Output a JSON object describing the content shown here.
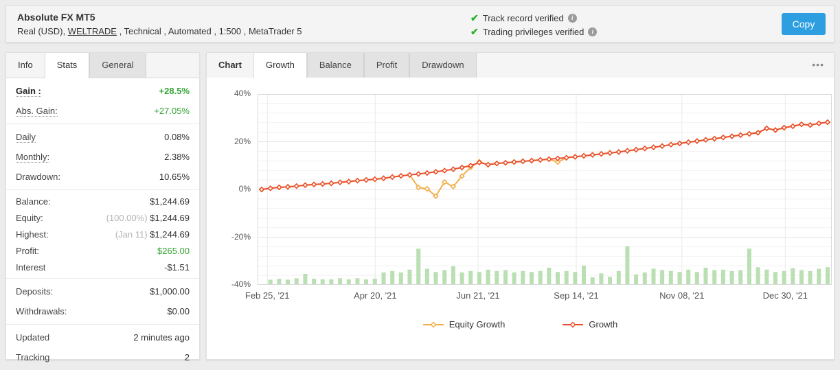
{
  "header": {
    "title": "Absolute FX MT5",
    "subtitle_pre": "Real (USD), ",
    "broker": "WELTRADE",
    "subtitle_post": " , Technical , Automated , 1:500 , MetaTrader 5",
    "verifications": [
      {
        "label": "Track record verified"
      },
      {
        "label": "Trading privileges verified"
      }
    ],
    "copy_button_label": "Copy"
  },
  "left_panel": {
    "tabs": [
      {
        "label": "Info",
        "style": "plain"
      },
      {
        "label": "Stats",
        "style": "active"
      },
      {
        "label": "General",
        "style": "inactive"
      }
    ],
    "groups": [
      {
        "rows": [
          {
            "label": "Gain :",
            "value": "+28.5%",
            "label_style": "bold dotted",
            "value_style": "green bold"
          },
          {
            "label": "Abs. Gain:",
            "value": "+27.05%",
            "label_style": "dotted",
            "value_style": "green"
          }
        ]
      },
      {
        "rows": [
          {
            "label": "Daily",
            "value": "0.08%",
            "label_style": "dotted"
          },
          {
            "label": "Monthly:",
            "value": "2.38%",
            "label_style": "dotted"
          },
          {
            "label": "Drawdown:",
            "value": "10.65%"
          }
        ]
      },
      {
        "compact": true,
        "rows": [
          {
            "label": "Balance:",
            "value": "$1,244.69"
          },
          {
            "label": "Equity:",
            "value_prefix": "(100.00%) ",
            "value": "$1,244.69"
          },
          {
            "label": "Highest:",
            "value_prefix": "(Jan 11) ",
            "value": "$1,244.69"
          },
          {
            "label": "Profit:",
            "value": "$265.00",
            "value_style": "green"
          },
          {
            "label": "Interest",
            "value": "-$1.51"
          }
        ]
      },
      {
        "rows": [
          {
            "label": "Deposits:",
            "value": "$1,000.00"
          },
          {
            "label": "Withdrawals:",
            "value": "$0.00"
          }
        ]
      },
      {
        "rows": [
          {
            "label": "Updated",
            "value": "2 minutes ago"
          },
          {
            "label": "Tracking",
            "value": "2"
          }
        ]
      }
    ]
  },
  "chart_panel": {
    "tabs": [
      {
        "label": "Chart",
        "style": "title"
      },
      {
        "label": "Growth",
        "style": "active"
      },
      {
        "label": "Balance",
        "style": "inactive"
      },
      {
        "label": "Profit",
        "style": "inactive"
      },
      {
        "label": "Drawdown",
        "style": "inactive"
      }
    ],
    "options_menu_icon": "•••"
  },
  "chart_data": {
    "type": "line",
    "title": "Account growth over time",
    "ylim": [
      -40,
      40
    ],
    "y_ticks": [
      40,
      20,
      0,
      -20,
      -40
    ],
    "y_tick_suffix": "%",
    "grid": {
      "major_step": 20,
      "minor_step": 4,
      "major_color": "#e3e3e3",
      "minor_color": "#f1f1f1",
      "vline_color": "#eaeaea",
      "frame_color": "#d9d9d9"
    },
    "x_tick_labels": [
      "Feb 25, '21",
      "Apr 20, '21",
      "Jun 21, '21",
      "Sep 14, '21",
      "Nov 08, '21",
      "Dec 30, '21"
    ],
    "x_tick_fractions": [
      0.017,
      0.205,
      0.384,
      0.555,
      0.739,
      0.919
    ],
    "series": [
      {
        "name": "Equity Growth",
        "color": "#F2AF4C",
        "values": [
          0.0,
          0.5,
          0.9,
          1.1,
          1.4,
          1.8,
          2.1,
          2.3,
          2.6,
          3.0,
          3.3,
          3.7,
          4.0,
          4.3,
          4.7,
          5.2,
          5.7,
          6.1,
          0.8,
          0.3,
          -2.8,
          3.1,
          1.2,
          5.6,
          9.3,
          11.6,
          10.4,
          10.9,
          11.2,
          11.5,
          11.8,
          12.1,
          12.4,
          12.7,
          11.5,
          13.3,
          13.7,
          14.1,
          14.5,
          14.9,
          15.3,
          15.7,
          16.2,
          16.7,
          17.2,
          17.7,
          18.2,
          18.8,
          19.3,
          19.8,
          20.3,
          20.8,
          21.3,
          21.8,
          22.3,
          22.8,
          23.3,
          23.8,
          25.6,
          24.9,
          25.9,
          26.5,
          27.3,
          27.0,
          27.7,
          28.2
        ]
      },
      {
        "name": "Growth",
        "color": "#E8512C",
        "values": [
          0.0,
          0.5,
          0.9,
          1.1,
          1.4,
          1.8,
          2.1,
          2.3,
          2.6,
          3.0,
          3.3,
          3.7,
          4.0,
          4.3,
          4.7,
          5.2,
          5.7,
          6.1,
          6.5,
          6.9,
          7.4,
          7.9,
          8.5,
          9.2,
          10.0,
          11.3,
          10.4,
          10.9,
          11.2,
          11.5,
          11.8,
          12.1,
          12.4,
          12.7,
          13.0,
          13.3,
          13.7,
          14.1,
          14.5,
          14.9,
          15.3,
          15.7,
          16.2,
          16.7,
          17.2,
          17.7,
          18.2,
          18.8,
          19.3,
          19.8,
          20.3,
          20.8,
          21.3,
          21.8,
          22.3,
          22.8,
          23.3,
          23.8,
          25.6,
          24.9,
          25.9,
          26.5,
          27.3,
          27.0,
          27.7,
          28.2
        ]
      }
    ],
    "bars": {
      "name": "activity",
      "color": "#BADFB2",
      "baseline": -40,
      "values": [
        0,
        2.2,
        2.6,
        2.2,
        2.8,
        4.6,
        2.6,
        2.3,
        2.3,
        2.8,
        2.3,
        2.8,
        2.3,
        2.6,
        5.2,
        5.8,
        5.2,
        6.4,
        15.2,
        6.8,
        5.4,
        6.2,
        7.8,
        5.2,
        5.8,
        5.4,
        6.4,
        5.8,
        6.2,
        5.2,
        5.8,
        5.4,
        5.8,
        7.2,
        5.4,
        5.8,
        5.4,
        8.0,
        3.2,
        4.8,
        3.4,
        5.8,
        16.2,
        4.4,
        5.2,
        6.8,
        6.2,
        5.8,
        5.4,
        6.4,
        5.4,
        7.2,
        6.2,
        6.4,
        5.8,
        6.2,
        15.2,
        7.4,
        6.4,
        5.4,
        5.8,
        7.0,
        6.2,
        5.8,
        6.8,
        7.4
      ]
    },
    "legend": [
      {
        "label": "Equity Growth",
        "color": "#F2AF4C"
      },
      {
        "label": "Growth",
        "color": "#E8512C"
      }
    ],
    "legend_position": "bottom"
  }
}
